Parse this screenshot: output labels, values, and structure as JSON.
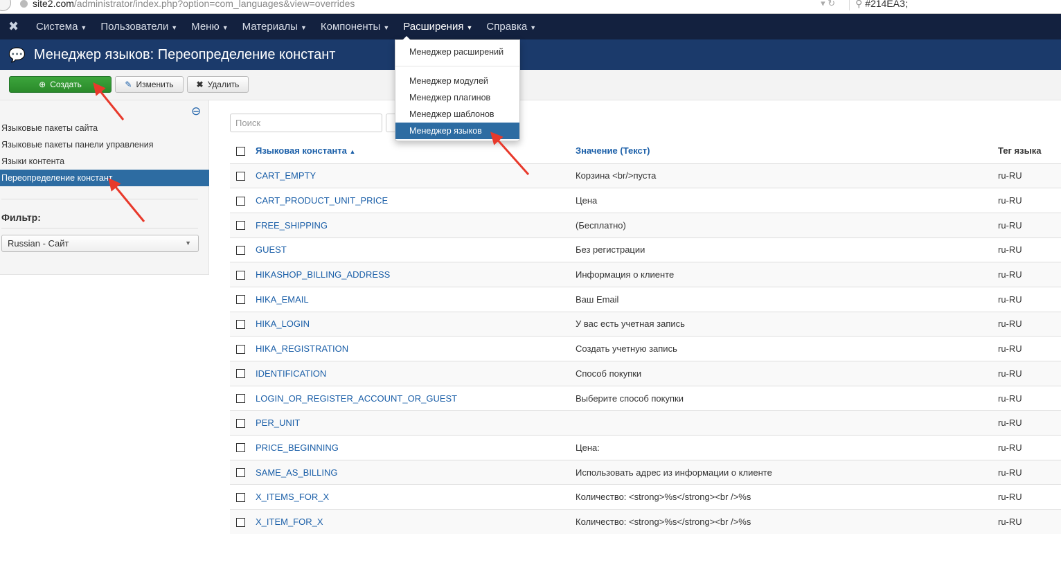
{
  "browser": {
    "url_host": "site2.com",
    "url_path": "/administrator/index.php?option=com_languages&view=overrides",
    "search": "#214EA3;"
  },
  "nav": {
    "items": [
      "Система",
      "Пользователи",
      "Меню",
      "Материалы",
      "Компоненты",
      "Расширения",
      "Справка"
    ]
  },
  "header": {
    "title": "Менеджер языков: Переопределение констант"
  },
  "toolbar": {
    "create": "Создать",
    "edit": "Изменить",
    "delete": "Удалить"
  },
  "sidebar": {
    "items": [
      "Языковые пакеты сайта",
      "Языковые пакеты панели управления",
      "Языки контента",
      "Переопределение констант"
    ],
    "filter_label": "Фильтр:",
    "filter_value": "Russian - Сайт"
  },
  "search": {
    "placeholder": "Поиск"
  },
  "dropdown": {
    "items": [
      "Менеджер расширений",
      "Менеджер модулей",
      "Менеджер плагинов",
      "Менеджер шаблонов",
      "Менеджер языков"
    ]
  },
  "table": {
    "headers": [
      "Языковая константа",
      "Значение (Текст)",
      "Тег языка"
    ],
    "rows": [
      [
        "CART_EMPTY",
        "Корзина <br/>пуста",
        "ru-RU"
      ],
      [
        "CART_PRODUCT_UNIT_PRICE",
        "Цена",
        "ru-RU"
      ],
      [
        "FREE_SHIPPING",
        "(Бесплатно)",
        "ru-RU"
      ],
      [
        "GUEST",
        "Без регистрации",
        "ru-RU"
      ],
      [
        "HIKASHOP_BILLING_ADDRESS",
        "Информация о клиенте",
        "ru-RU"
      ],
      [
        "HIKA_EMAIL",
        "Ваш Email",
        "ru-RU"
      ],
      [
        "HIKA_LOGIN",
        "У вас есть учетная запись",
        "ru-RU"
      ],
      [
        "HIKA_REGISTRATION",
        "Создать учетную запись",
        "ru-RU"
      ],
      [
        "IDENTIFICATION",
        "Способ покупки",
        "ru-RU"
      ],
      [
        "LOGIN_OR_REGISTER_ACCOUNT_OR_GUEST",
        "Выберите способ покупки",
        "ru-RU"
      ],
      [
        "PER_UNIT",
        "",
        "ru-RU"
      ],
      [
        "PRICE_BEGINNING",
        "Цена:",
        "ru-RU"
      ],
      [
        "SAME_AS_BILLING",
        "Использовать адрес из информации о клиенте",
        "ru-RU"
      ],
      [
        "X_ITEMS_FOR_X",
        "Количество: <strong>%s</strong><br />%s",
        "ru-RU"
      ],
      [
        "X_ITEM_FOR_X",
        "Количество: <strong>%s</strong><br />%s",
        "ru-RU"
      ]
    ]
  }
}
